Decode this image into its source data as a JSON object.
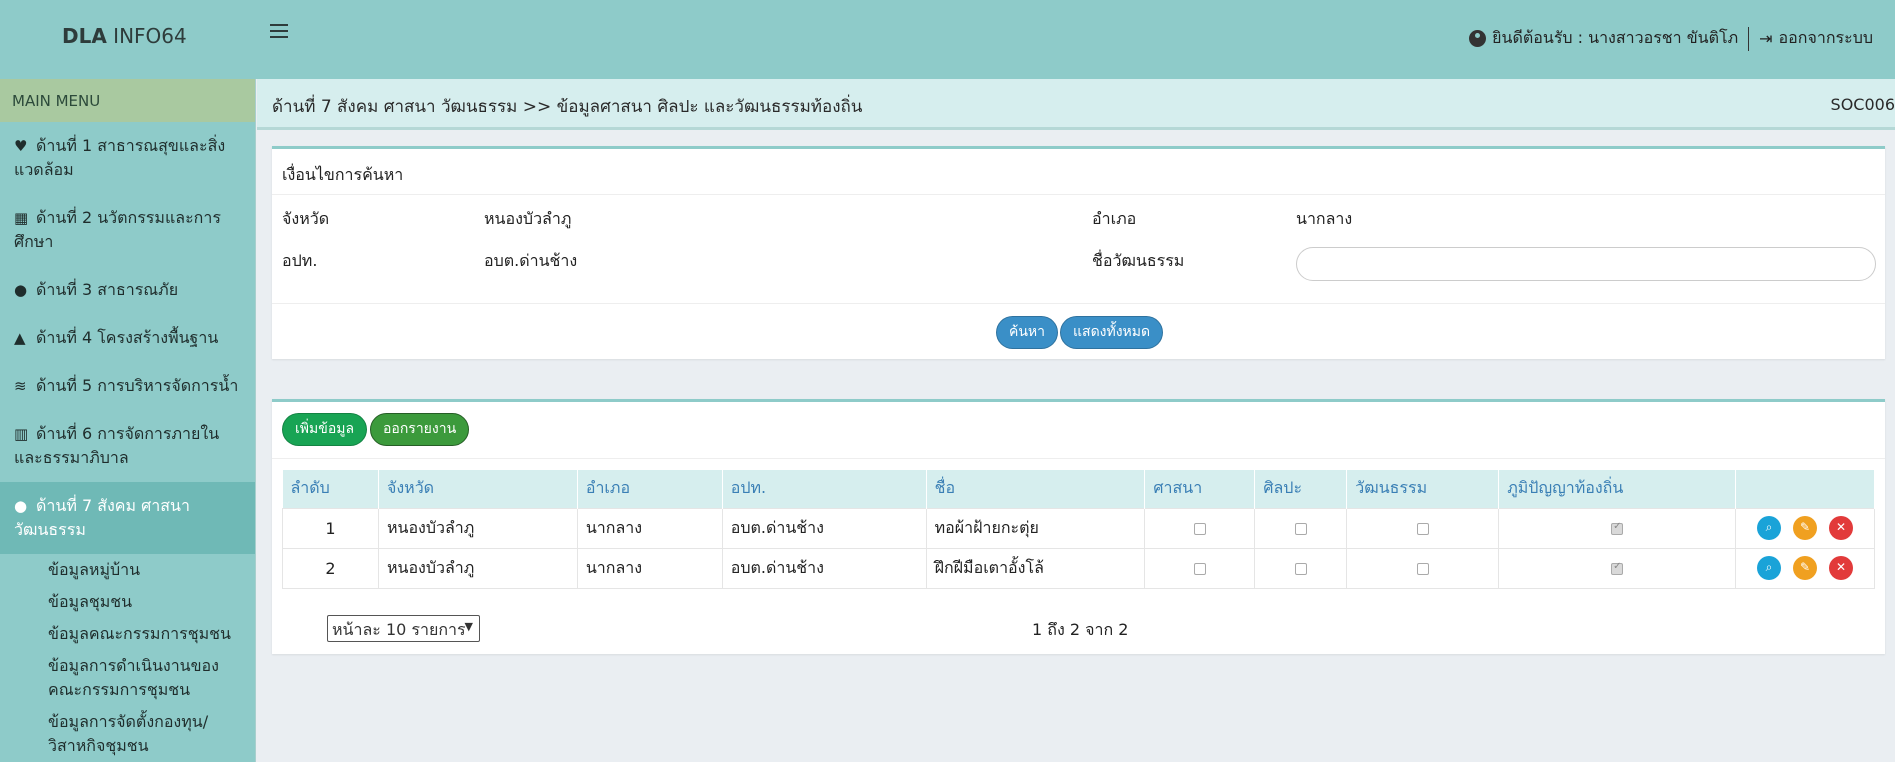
{
  "header": {
    "brand_bold": "DLA",
    "brand_rest": " INFO64",
    "welcome": "ยินดีต้อนรับ : นางสาวอรชา ขันติโภ",
    "logout": "ออกจากระบบ"
  },
  "sidebar": {
    "title": "MAIN MENU",
    "items": [
      {
        "icon": "heartbeat-icon",
        "glyph": "♥",
        "label": "ด้านที่ 1 สาธารณสุขและสิ่งแวดล้อม"
      },
      {
        "icon": "school-icon",
        "glyph": "▦",
        "label": "ด้านที่ 2 นวัตกรรมและการศึกษา"
      },
      {
        "icon": "user-shield-icon",
        "glyph": "●",
        "label": "ด้านที่ 3 สาธารณภัย"
      },
      {
        "icon": "road-icon",
        "glyph": "▲",
        "label": "ด้านที่ 4 โครงสร้างพื้นฐาน"
      },
      {
        "icon": "water-icon",
        "glyph": "≋",
        "label": "ด้านที่ 5 การบริหารจัดการน้ำ"
      },
      {
        "icon": "building-icon",
        "glyph": "▥",
        "label": "ด้านที่ 6 การจัดการภายในและธรรมาภิบาล"
      },
      {
        "icon": "users-icon",
        "glyph": "●●",
        "label": "ด้านที่ 7 สังคม ศาสนา วัฒนธรรม"
      }
    ],
    "sub_items": [
      "ข้อมูลหมู่บ้าน",
      "ข้อมูลชุมชน",
      "ข้อมูลคณะกรรมการชุมชน",
      "ข้อมูลการดำเนินงานของคณะกรรมการชุมชน",
      "ข้อมูลการจัดตั้งกองทุน/วิสาหกิจชุมชน"
    ]
  },
  "breadcrumb": {
    "path": "ด้านที่ 7 สังคม ศาสนา วัฒนธรรม >>  ข้อมูลศาสนา ศิลปะ และวัฒนธรรมท้องถิ่น",
    "code": "SOC006"
  },
  "search": {
    "title": "เงื่อนไขการค้นหา",
    "province_label": "จังหวัด",
    "province_value": "หนองบัวลำภู",
    "district_label": "อำเภอ",
    "district_value": "นากลาง",
    "org_label": "อปท.",
    "org_value": "อบต.ด่านช้าง",
    "culture_label": "ชื่อวัฒนธรรม",
    "culture_value": "",
    "search_button": "ค้นหา",
    "show_all_button": "แสดงทั้งหมด"
  },
  "table": {
    "add_button": "เพิ่มข้อมูล",
    "report_button": "ออกรายงาน",
    "columns": [
      "ลำดับ",
      "จังหวัด",
      "อำเภอ",
      "อปท.",
      "ชื่อ",
      "ศาสนา",
      "ศิลปะ",
      "วัฒนธรรม",
      "ภูมิปัญญาท้องถิ่น",
      ""
    ],
    "rows": [
      {
        "no": "1",
        "province": "หนองบัวลำภู",
        "district": "นากลาง",
        "org": "อบต.ด่านช้าง",
        "name": "ทอผ้าฝ้ายกะตุ่ย",
        "religion": false,
        "art": false,
        "culture": false,
        "wisdom": true
      },
      {
        "no": "2",
        "province": "หนองบัวลำภู",
        "district": "นากลาง",
        "org": "อบต.ด่านช้าง",
        "name": "ฝึกฝีมือเตาอั้งโล้",
        "religion": false,
        "art": false,
        "culture": false,
        "wisdom": true
      }
    ],
    "page_size": "หน้าละ 10 รายการ",
    "page_info": "1 ถึง 2 จาก 2"
  },
  "colors": {
    "header_bg": "#8ecbc9",
    "sidebar_active": "#6fb9b6",
    "table_header_bg": "#d6eeee",
    "button_blue": "#3a8fc7",
    "button_green": "#18a454"
  }
}
